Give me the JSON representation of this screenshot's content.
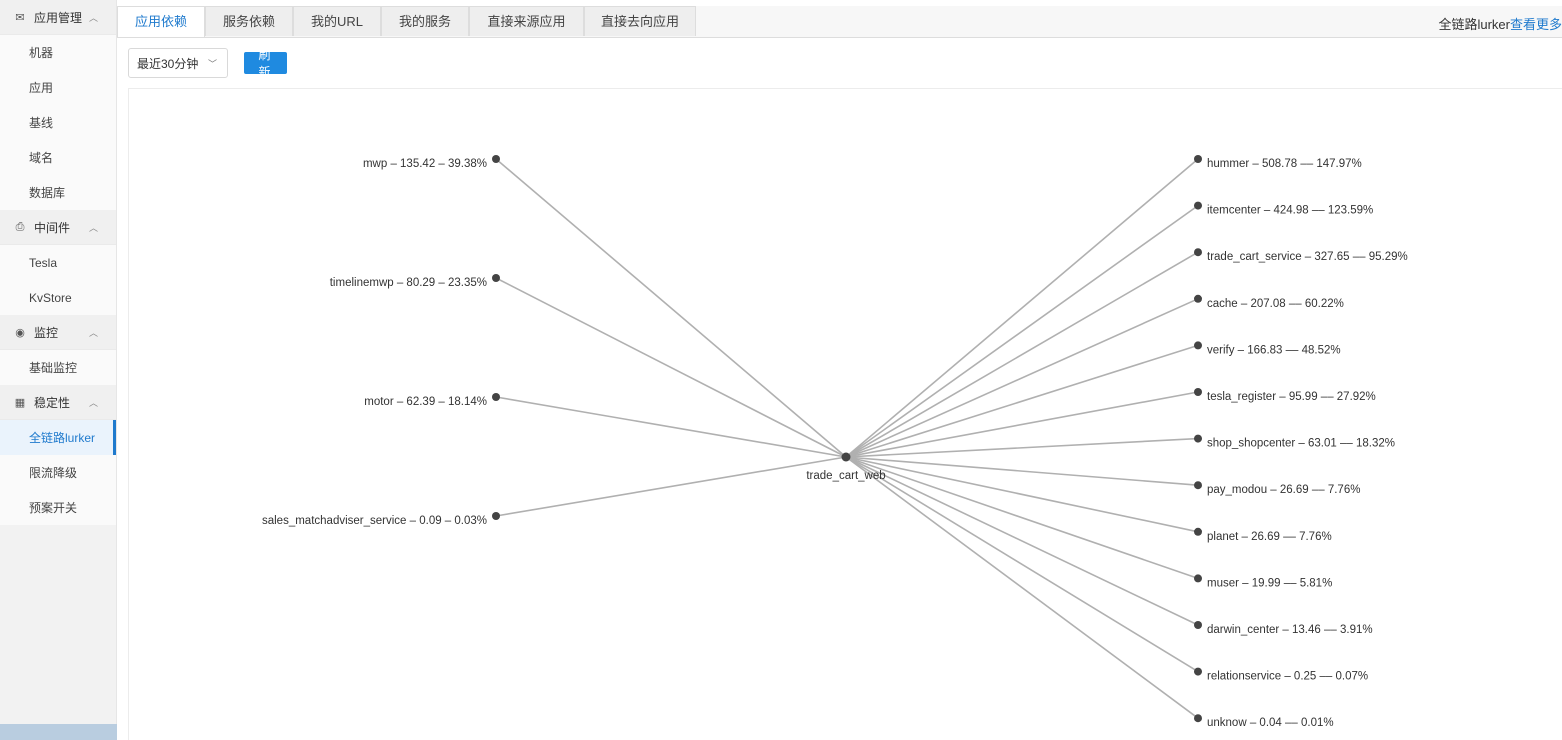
{
  "sidebar": {
    "groups": [
      {
        "label": "应用管理",
        "icon": "mail-icon",
        "items": [
          "机器",
          "应用",
          "基线",
          "域名",
          "数据库"
        ]
      },
      {
        "label": "中间件",
        "icon": "printer-icon",
        "items": [
          "Tesla",
          "KvStore"
        ]
      },
      {
        "label": "监控",
        "icon": "eye-icon",
        "items": [
          "基础监控"
        ]
      },
      {
        "label": "稳定性",
        "icon": "grid-icon",
        "items": [
          "全链路lurker",
          "限流降级",
          "预案开关"
        ]
      }
    ],
    "active_item": "全链路lurker"
  },
  "tabs": [
    "应用依赖",
    "服务依赖",
    "我的URL",
    "我的服务",
    "直接来源应用",
    "直接去向应用"
  ],
  "active_tab": "应用依赖",
  "header": {
    "breadcrumb": "全链路lurker",
    "more_link": "查看更多"
  },
  "toolbar": {
    "time_range": "最近30分钟",
    "refresh_label": "刷 新"
  },
  "colors": {
    "accent": "#1f7acd",
    "button": "#1f8ae0",
    "edge": "#b0b0b0",
    "node": "#444444"
  },
  "graph": {
    "center": "trade_cart_web",
    "sources": [
      "mwp – 135.42 – 39.38%",
      "timelinemwp – 80.29 – 23.35%",
      "motor – 62.39 – 18.14%",
      "sales_matchadviser_service – 0.09 – 0.03%"
    ],
    "targets": [
      "hummer – 508.78 –– 147.97%",
      "itemcenter – 424.98 –– 123.59%",
      "trade_cart_service – 327.65 –– 95.29%",
      "cache – 207.08 –– 60.22%",
      "verify – 166.83 –– 48.52%",
      "tesla_register – 95.99 –– 27.92%",
      "shop_shopcenter – 63.01 –– 18.32%",
      "pay_modou – 26.69 –– 7.76%",
      "planet – 26.69 –– 7.76%",
      "muser – 19.99 –– 5.81%",
      "darwin_center – 13.46 –– 3.91%",
      "relationservice – 0.25 –– 0.07%",
      "unknow – 0.04 –– 0.01%"
    ]
  }
}
